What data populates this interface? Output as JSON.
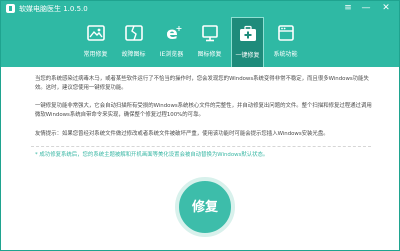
{
  "app": {
    "title": "软媒电脑医生 1.0.5.0",
    "window_controls": {
      "menu": "≡",
      "minimize": "—",
      "close": "✕"
    }
  },
  "toolbar": {
    "active_index": 4,
    "items": [
      {
        "label": "常用修复",
        "icon": "image-repair-icon"
      },
      {
        "label": "故障图标",
        "icon": "broken-image-icon"
      },
      {
        "label": "IE浏览器",
        "icon": "ie-icon"
      },
      {
        "label": "图标修复",
        "icon": "desktop-icon"
      },
      {
        "label": "一键修复",
        "icon": "medkit-icon"
      },
      {
        "label": "系统功能",
        "icon": "settings-icon"
      }
    ]
  },
  "content": {
    "paragraph_1": "当您的系统感染过病毒木马，或者某些软件运行了不恰当的操作时，您会发现您的Windows系统变得非常不稳定，而且很多Windows功能失效。这时，建议您使用一键修复功能。",
    "paragraph_2": "一键修复功能非常强大，它会自动扫描所有受损的Windows系统核心文件的完整性，并自动修复出问题的文件。整个扫描和修复过程通过调用微软Windows系统自带命令来实现，确保整个修复过程100%的可靠。",
    "paragraph_3": "友情提示：如果您曾经对系统文件做过修改或者系统文件被破坏严重，使用该功能时可能会提示您插入Windows安装光盘。",
    "notice": "* 成功修复系统后，您的系统主题被解和开机画面等美化设置会被自动替换为Windows默认状态。",
    "repair_button": "修复"
  },
  "colors": {
    "header": "#2fb9a4",
    "active_tab": "#1e8b7b",
    "accent_text": "#39b7a4",
    "button": "#3dbdaa"
  }
}
